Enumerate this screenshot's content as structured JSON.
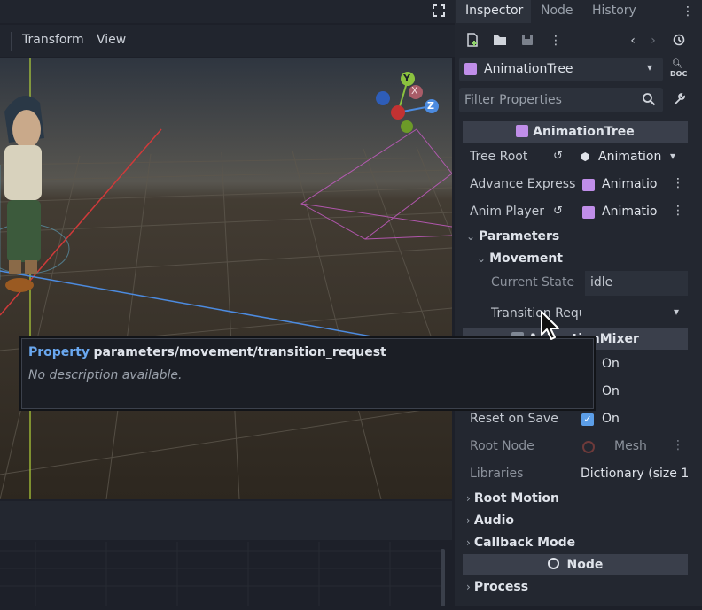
{
  "viewport_menu": {
    "transform_label": "Transform",
    "view_label": "View"
  },
  "gizmo_axes": {
    "y": "Y",
    "x": "X",
    "z": "Z"
  },
  "inspector": {
    "tabs": [
      {
        "label": "Inspector"
      },
      {
        "label": "Node"
      },
      {
        "label": "History"
      }
    ],
    "node_selector": "AnimationTree",
    "doc_label": "DOC",
    "filter_placeholder": "Filter Properties",
    "section_title": "AnimationTree",
    "props": {
      "tree_root": {
        "label": "Tree Root",
        "value": "Animation"
      },
      "advance_expr": {
        "label": "Advance Expressi",
        "value": "Animatio"
      },
      "anim_player": {
        "label": "Anim Player",
        "value": "Animatio"
      }
    },
    "parameters_label": "Parameters",
    "movement_label": "Movement",
    "current_state": {
      "label": "Current State",
      "value": "idle"
    },
    "transition_request": {
      "label": "Transition Requ"
    },
    "mixer_section": "AnimationMixer",
    "active": {
      "value": "On"
    },
    "deterministic": {
      "value": "On"
    },
    "reset_on_save": {
      "label": "Reset on Save",
      "value": "On"
    },
    "root_node": {
      "label": "Root Node",
      "value": "Mesh"
    },
    "libraries": {
      "label": "Libraries",
      "value": "Dictionary (size 1"
    },
    "groups": {
      "root_motion": "Root Motion",
      "audio": "Audio",
      "callback_mode": "Callback Mode",
      "process": "Process"
    },
    "node_section": "Node"
  },
  "tooltip": {
    "keyword": "Property",
    "path": "parameters/movement/transition_request",
    "description": "No description available."
  },
  "colors": {
    "accent": "#5c9ee8",
    "tooltip_keyword": "#6aa8f0",
    "node_purple": "#c08ee9"
  }
}
